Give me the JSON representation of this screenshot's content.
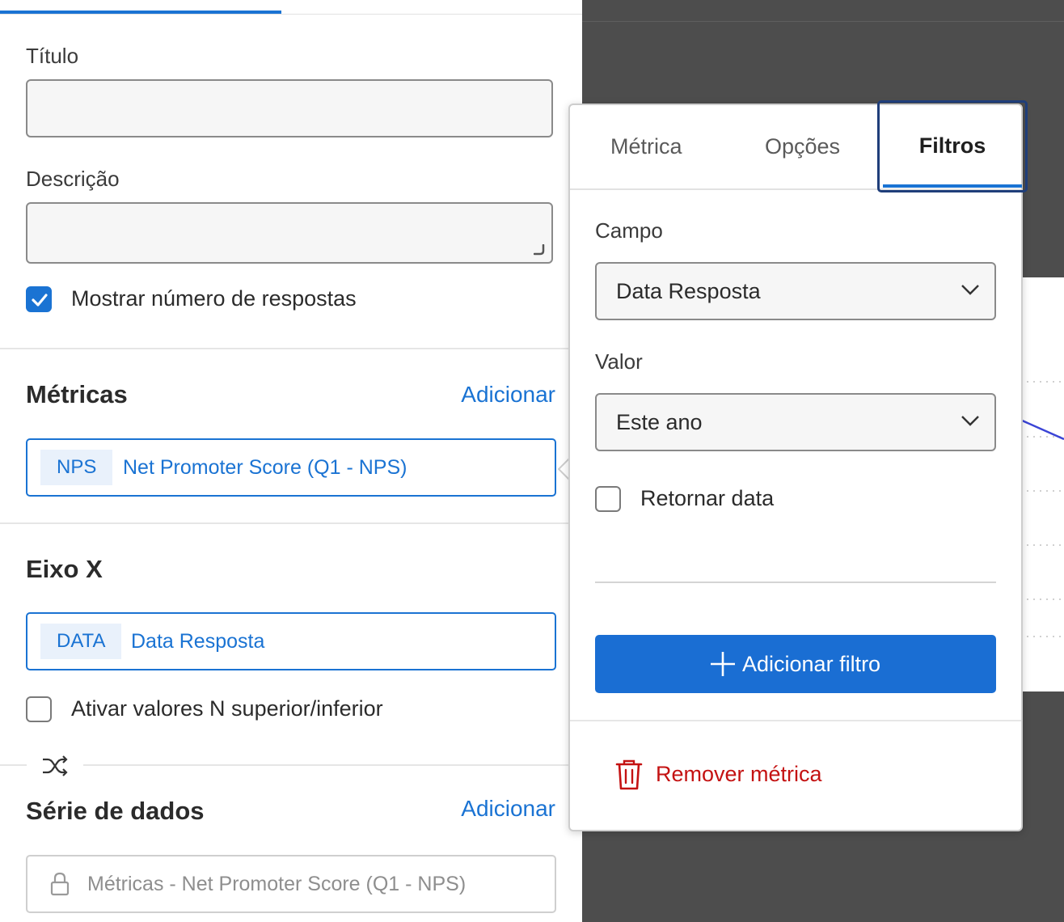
{
  "editor": {
    "title_label": "Título",
    "title_value": "",
    "description_label": "Descrição",
    "description_value": "",
    "show_responses_label": "Mostrar número de respostas",
    "show_responses_checked": true
  },
  "metrics": {
    "heading": "Métricas",
    "add_label": "Adicionar",
    "item": {
      "tag": "NPS",
      "name": "Net Promoter Score (Q1 - NPS)"
    }
  },
  "x_axis": {
    "heading": "Eixo X",
    "item": {
      "tag": "DATA",
      "name": "Data Resposta"
    },
    "top_n_label": "Ativar valores N superior/inferior",
    "top_n_checked": false
  },
  "data_series": {
    "heading": "Série de dados",
    "add_label": "Adicionar",
    "locked_value": "Métricas - Net Promoter Score (Q1 - NPS)"
  },
  "popover": {
    "tabs": [
      {
        "label": "Métrica",
        "active": false
      },
      {
        "label": "Opções",
        "active": false
      },
      {
        "label": "Filtros",
        "active": true
      }
    ],
    "field_label": "Campo",
    "field_value": "Data Resposta",
    "value_label": "Valor",
    "value_value": "Este ano",
    "return_date_label": "Retornar data",
    "return_date_checked": false,
    "add_filter_label": "Adicionar filtro",
    "remove_metric_label": "Remover métrica"
  },
  "icons": {
    "checkbox": "checkmark-icon",
    "shuffle": "shuffle-icon",
    "lock": "lock-icon",
    "chevron": "chevron-down-icon",
    "plus": "plus-icon",
    "trash": "trash-icon"
  },
  "colors": {
    "accent": "#1a73d3",
    "danger": "#c41212",
    "background_dark": "#4d4d4d"
  }
}
